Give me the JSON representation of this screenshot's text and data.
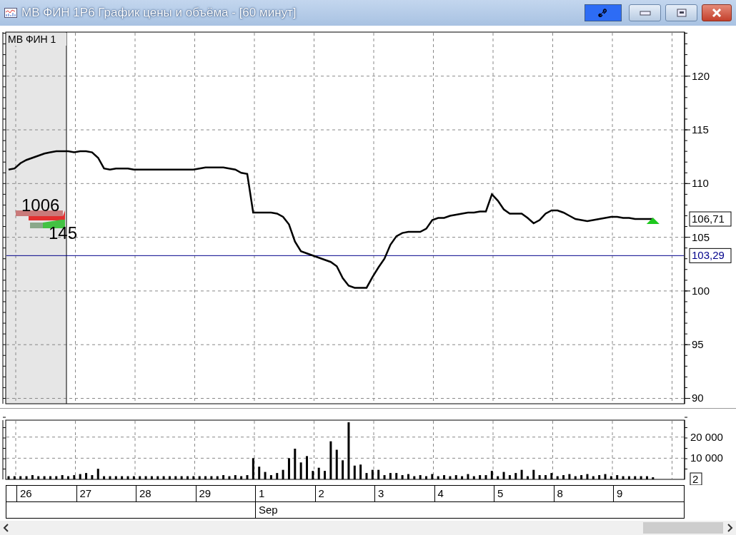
{
  "window": {
    "title": "МВ ФИН 1Р6 График цены и объёма - [60 минут]"
  },
  "legend": {
    "label": "МВ ФИН 1"
  },
  "depth": {
    "bid_label": "1006",
    "ask_label": "145"
  },
  "price_chart": {
    "last_price": "106,71",
    "chart_data": {
      "type": "line",
      "grid": true,
      "ylim": [
        89.5,
        124.1
      ],
      "ref_lines": [
        {
          "axis": "y",
          "value": 103.29,
          "label": "103,29",
          "color": "#00008b"
        }
      ],
      "yticks": [
        90,
        95,
        100,
        105,
        110,
        115,
        120
      ],
      "series": [
        {
          "color": "#000000",
          "values": [
            111.3,
            111.4,
            111.9,
            112.2,
            112.4,
            112.6,
            112.8,
            112.9,
            113.0,
            113.0,
            113.0,
            112.9,
            113.0,
            113.0,
            112.9,
            112.4,
            111.4,
            111.3,
            111.4,
            111.4,
            111.4,
            111.3,
            111.3,
            111.3,
            111.3,
            111.3,
            111.3,
            111.3,
            111.3,
            111.3,
            111.3,
            111.3,
            111.4,
            111.5,
            111.5,
            111.5,
            111.5,
            111.4,
            111.3,
            111.0,
            110.9,
            107.3,
            107.3,
            107.3,
            107.3,
            107.2,
            106.9,
            106.2,
            104.6,
            103.7,
            103.5,
            103.3,
            103.1,
            102.9,
            102.7,
            102.3,
            101.2,
            100.5,
            100.3,
            100.3,
            100.3,
            101.3,
            102.2,
            103.0,
            104.3,
            105.1,
            105.4,
            105.5,
            105.5,
            105.5,
            105.8,
            106.6,
            106.8,
            106.8,
            107.0,
            107.1,
            107.2,
            107.3,
            107.3,
            107.4,
            107.4,
            109.0,
            108.4,
            107.6,
            107.2,
            107.2,
            107.2,
            106.8,
            106.3,
            106.6,
            107.2,
            107.5,
            107.5,
            107.3,
            107.0,
            106.7,
            106.6,
            106.5,
            106.6,
            106.7,
            106.8,
            106.9,
            106.9,
            106.8,
            106.8,
            106.7,
            106.7,
            106.7,
            106.7
          ]
        }
      ]
    }
  },
  "volume_chart": {
    "scale_badge": "2",
    "chart_data": {
      "type": "bar",
      "grid": true,
      "ylim": [
        0,
        28000
      ],
      "yticks": [
        {
          "value": 10000,
          "label": "10 000"
        },
        {
          "value": 20000,
          "label": "20 000"
        }
      ],
      "values": [
        1500,
        1500,
        1500,
        1500,
        2000,
        1500,
        1500,
        1500,
        1500,
        2000,
        1500,
        2000,
        2500,
        3000,
        2000,
        5000,
        1500,
        1500,
        1500,
        1500,
        1500,
        1500,
        1500,
        1500,
        1500,
        1500,
        1500,
        1500,
        1500,
        1500,
        1500,
        1500,
        1500,
        1500,
        1500,
        1500,
        2000,
        1500,
        2000,
        1500,
        2000,
        10000,
        6000,
        3500,
        2000,
        3000,
        4500,
        10000,
        14500,
        8000,
        11000,
        4000,
        5500,
        4000,
        18000,
        14000,
        9000,
        27000,
        6500,
        7000,
        3000,
        4500,
        4500,
        2000,
        3000,
        3000,
        2000,
        2500,
        1500,
        2000,
        1500,
        2500,
        1500,
        2000,
        1500,
        2000,
        1500,
        2500,
        1500,
        2000,
        2000,
        4000,
        1500,
        3500,
        2000,
        3000,
        4500,
        1500,
        4500,
        2000,
        2000,
        3000,
        1500,
        2000,
        2500,
        1500,
        2000,
        2500,
        1500,
        2000,
        2500,
        1500,
        2000,
        1500,
        1500,
        1500,
        1500,
        1500,
        1000
      ]
    }
  },
  "date_axis": {
    "days": [
      "26",
      "27",
      "28",
      "29",
      "1",
      "2",
      "3",
      "4",
      "5",
      "8",
      "9"
    ],
    "month": "Sep"
  }
}
